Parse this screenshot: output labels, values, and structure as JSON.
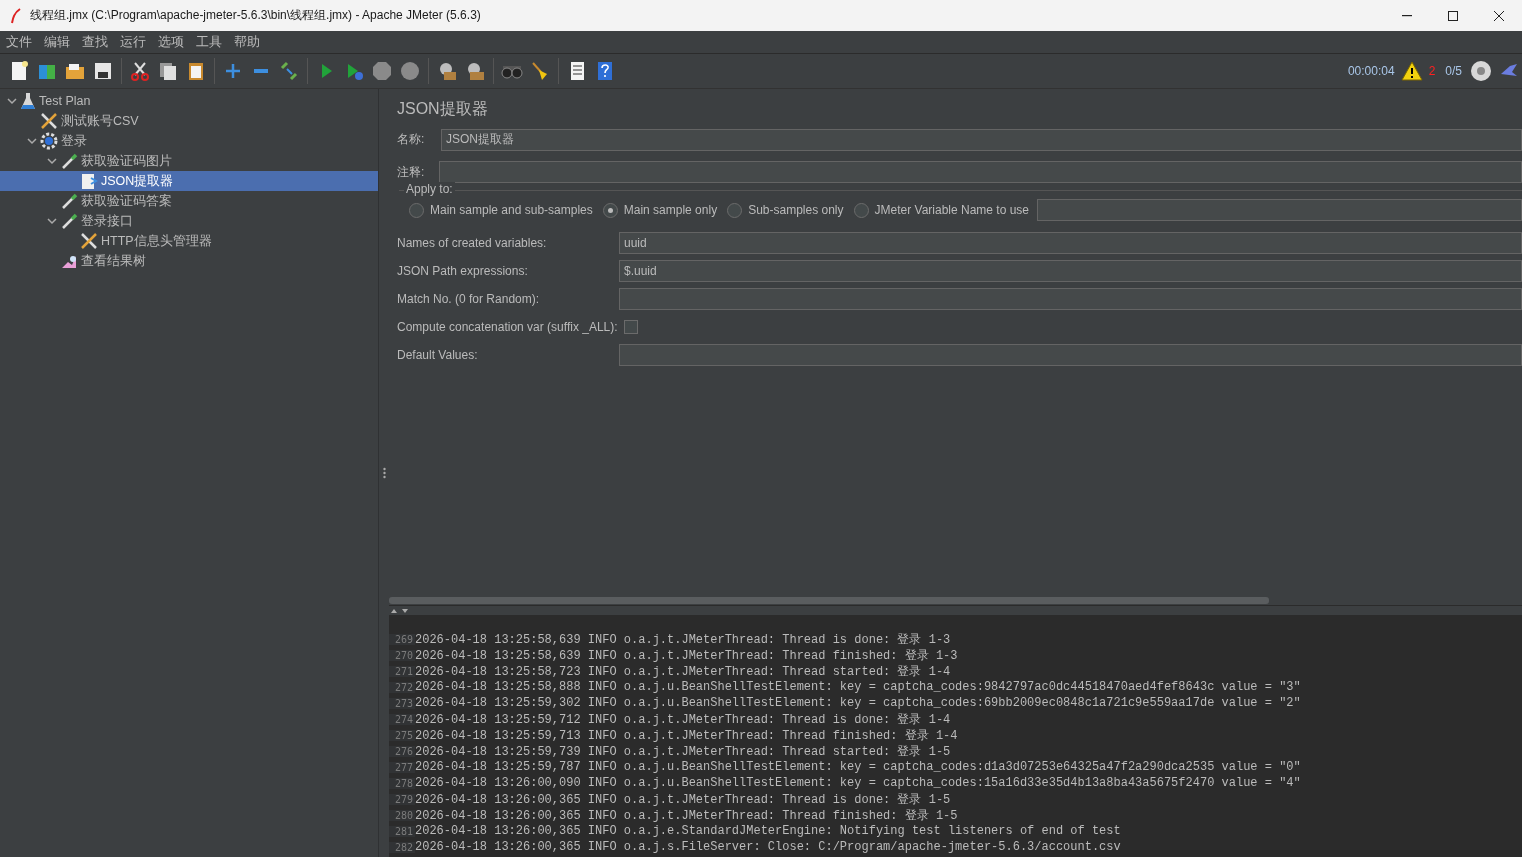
{
  "window": {
    "title": "线程组.jmx (C:\\Program\\apache-jmeter-5.6.3\\bin\\线程组.jmx) - Apache JMeter (5.6.3)"
  },
  "menu": [
    "文件",
    "编辑",
    "查找",
    "运行",
    "选项",
    "工具",
    "帮助"
  ],
  "status": {
    "elapsed": "00:00:04",
    "errors": "2",
    "threads": "0/5"
  },
  "tree": [
    {
      "label": "Test Plan",
      "kind": "plan",
      "expanded": true,
      "selected": false,
      "children": [
        {
          "label": "测试账号CSV",
          "kind": "config",
          "selected": false
        },
        {
          "label": "登录",
          "kind": "threadgroup",
          "expanded": true,
          "selected": false,
          "children": [
            {
              "label": "获取验证码图片",
              "kind": "sampler",
              "expanded": true,
              "selected": false,
              "children": [
                {
                  "label": "JSON提取器",
                  "kind": "extractor",
                  "selected": true
                }
              ]
            },
            {
              "label": "获取验证码答案",
              "kind": "sampler",
              "selected": false
            },
            {
              "label": "登录接口",
              "kind": "sampler",
              "expanded": true,
              "selected": false,
              "children": [
                {
                  "label": "HTTP信息头管理器",
                  "kind": "config",
                  "selected": false
                }
              ]
            },
            {
              "label": "查看结果树",
              "kind": "listener",
              "selected": false
            }
          ]
        }
      ]
    }
  ],
  "editor": {
    "title": "JSON提取器",
    "name_label": "名称:",
    "name_value": "JSON提取器",
    "comment_label": "注释:",
    "apply_to": {
      "legend": "Apply to:",
      "options": [
        {
          "label": "Main sample and sub-samples",
          "selected": false
        },
        {
          "label": "Main sample only",
          "selected": true
        },
        {
          "label": "Sub-samples only",
          "selected": false
        },
        {
          "label": "JMeter Variable Name to use",
          "selected": false
        }
      ]
    },
    "fields": [
      {
        "kind": "text",
        "label": "Names of created variables:",
        "value": "uuid"
      },
      {
        "kind": "text",
        "label": "JSON Path expressions:",
        "value": "$.uuid"
      },
      {
        "kind": "text",
        "label": "Match No. (0 for Random):"
      },
      {
        "kind": "checkbox",
        "label": "Compute concatenation var (suffix _ALL):",
        "checked": false
      },
      {
        "kind": "text",
        "label": "Default Values:"
      }
    ]
  },
  "log": [
    {
      "line": "269",
      "text": "2026-04-18 13:25:58,639 INFO o.a.j.t.JMeterThread: Thread is done: 登录 1-3"
    },
    {
      "line": "270",
      "text": "2026-04-18 13:25:58,639 INFO o.a.j.t.JMeterThread: Thread finished: 登录 1-3"
    },
    {
      "line": "271",
      "text": "2026-04-18 13:25:58,723 INFO o.a.j.t.JMeterThread: Thread started: 登录 1-4"
    },
    {
      "line": "272",
      "text": "2026-04-18 13:25:58,888 INFO o.a.j.u.BeanShellTestElement: key = captcha_codes:9842797ac0dc44518470aed4fef8643c value = \"3\""
    },
    {
      "line": "273",
      "text": "2026-04-18 13:25:59,302 INFO o.a.j.u.BeanShellTestElement: key = captcha_codes:69bb2009ec0848c1a721c9e559aa17de value = \"2\""
    },
    {
      "line": "274",
      "text": "2026-04-18 13:25:59,712 INFO o.a.j.t.JMeterThread: Thread is done: 登录 1-4"
    },
    {
      "line": "275",
      "text": "2026-04-18 13:25:59,713 INFO o.a.j.t.JMeterThread: Thread finished: 登录 1-4"
    },
    {
      "line": "276",
      "text": "2026-04-18 13:25:59,739 INFO o.a.j.t.JMeterThread: Thread started: 登录 1-5"
    },
    {
      "line": "277",
      "text": "2026-04-18 13:25:59,787 INFO o.a.j.u.BeanShellTestElement: key = captcha_codes:d1a3d07253e64325a47f2a290dca2535 value = \"0\""
    },
    {
      "line": "278",
      "text": "2026-04-18 13:26:00,090 INFO o.a.j.u.BeanShellTestElement: key = captcha_codes:15a16d33e35d4b13a8ba43a5675f2470 value = \"4\""
    },
    {
      "line": "279",
      "text": "2026-04-18 13:26:00,365 INFO o.a.j.t.JMeterThread: Thread is done: 登录 1-5"
    },
    {
      "line": "280",
      "text": "2026-04-18 13:26:00,365 INFO o.a.j.t.JMeterThread: Thread finished: 登录 1-5"
    },
    {
      "line": "281",
      "text": "2026-04-18 13:26:00,365 INFO o.a.j.e.StandardJMeterEngine: Notifying test listeners of end of test"
    },
    {
      "line": "282",
      "text": "2026-04-18 13:26:00,365 INFO o.a.j.s.FileServer: Close: C:/Program/apache-jmeter-5.6.3/account.csv"
    }
  ]
}
